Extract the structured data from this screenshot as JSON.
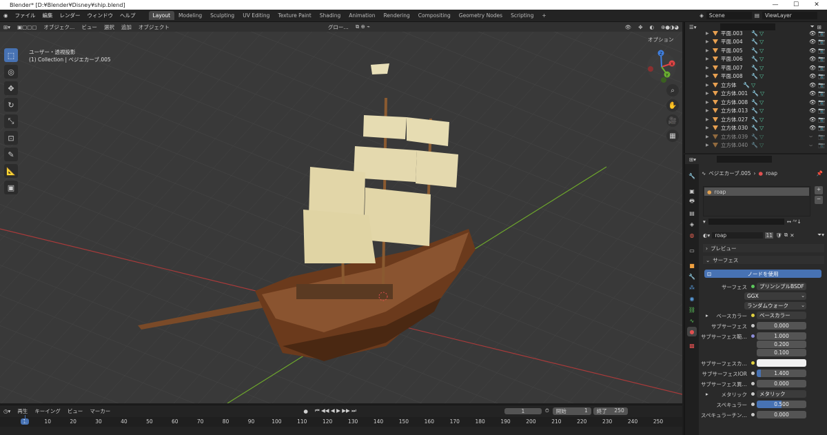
{
  "window": {
    "title": "Blender* [D:¥Blender¥Disney¥ship.blend]",
    "minimize": "—",
    "maximize": "☐",
    "close": "✕"
  },
  "menu": [
    "ファイル",
    "編集",
    "レンダー",
    "ウィンドウ",
    "ヘルプ"
  ],
  "workspaces": [
    "Layout",
    "Modeling",
    "Sculpting",
    "UV Editing",
    "Texture Paint",
    "Shading",
    "Animation",
    "Rendering",
    "Compositing",
    "Geometry Nodes",
    "Scripting"
  ],
  "active_workspace": "Layout",
  "scene": "Scene",
  "viewlayer": "ViewLayer",
  "viewport": {
    "mode": "オブジェク…",
    "menus": [
      "ビュー",
      "選択",
      "追加",
      "オブジェクト"
    ],
    "transform": "グロー…",
    "options": "オプション",
    "overlay1": "ユーザー・透視投影",
    "overlay2": "(1) Collection | ベジエカーブ.005",
    "axes": {
      "x": "X",
      "y": "Y",
      "z": "Z"
    }
  },
  "outliner": [
    {
      "name": "平面.003"
    },
    {
      "name": "平面.004"
    },
    {
      "name": "平面.005"
    },
    {
      "name": "平面.006"
    },
    {
      "name": "平面.007"
    },
    {
      "name": "平面.008"
    },
    {
      "name": "立方体"
    },
    {
      "name": "立方体.001"
    },
    {
      "name": "立方体.008"
    },
    {
      "name": "立方体.013"
    },
    {
      "name": "立方体.027"
    },
    {
      "name": "立方体.030"
    },
    {
      "name": "立方体.039"
    },
    {
      "name": "立方体.040"
    }
  ],
  "props": {
    "breadcrumb_obj": "ベジエカーブ.005",
    "breadcrumb_mat": "roap",
    "slot": "roap",
    "material_name": "roap",
    "users": "11",
    "preview": "プレビュー",
    "surface_panel": "サーフェス",
    "use_nodes": "ノードを使用",
    "rows": [
      {
        "label": "サーフェス",
        "value": "プリンシプルBSDF"
      },
      {
        "label": "",
        "value": "GGX"
      },
      {
        "label": "",
        "value": "ランダムウォーク"
      },
      {
        "label": "ベースカラー",
        "value": "ベースカラー"
      },
      {
        "label": "サブサーフェス",
        "value": "0.000"
      },
      {
        "label": "サブサーフェス範…",
        "value": "1.000"
      },
      {
        "label": "",
        "value": "0.200"
      },
      {
        "label": "",
        "value": "0.100"
      },
      {
        "label": "サブサーフェスカ…",
        "value": ""
      },
      {
        "label": "サブサーフェスIOR",
        "value": "1.400"
      },
      {
        "label": "サブサーフェス異…",
        "value": "0.000"
      },
      {
        "label": "メタリック",
        "value": "メタリック"
      },
      {
        "label": "スペキュラー",
        "value": "0.500"
      },
      {
        "label": "スペキュラーチン…",
        "value": "0.000"
      }
    ]
  },
  "timeline": {
    "menus": [
      "再生",
      "キーイング",
      "ビュー",
      "マーカー"
    ],
    "current": "1",
    "start_label": "開始",
    "start": "1",
    "end_label": "終了",
    "end": "250",
    "ticks": [
      "1",
      "10",
      "20",
      "30",
      "40",
      "50",
      "60",
      "70",
      "80",
      "90",
      "100",
      "110",
      "120",
      "130",
      "140",
      "150",
      "160",
      "170",
      "180",
      "190",
      "200",
      "210",
      "220",
      "230",
      "240",
      "250"
    ]
  }
}
